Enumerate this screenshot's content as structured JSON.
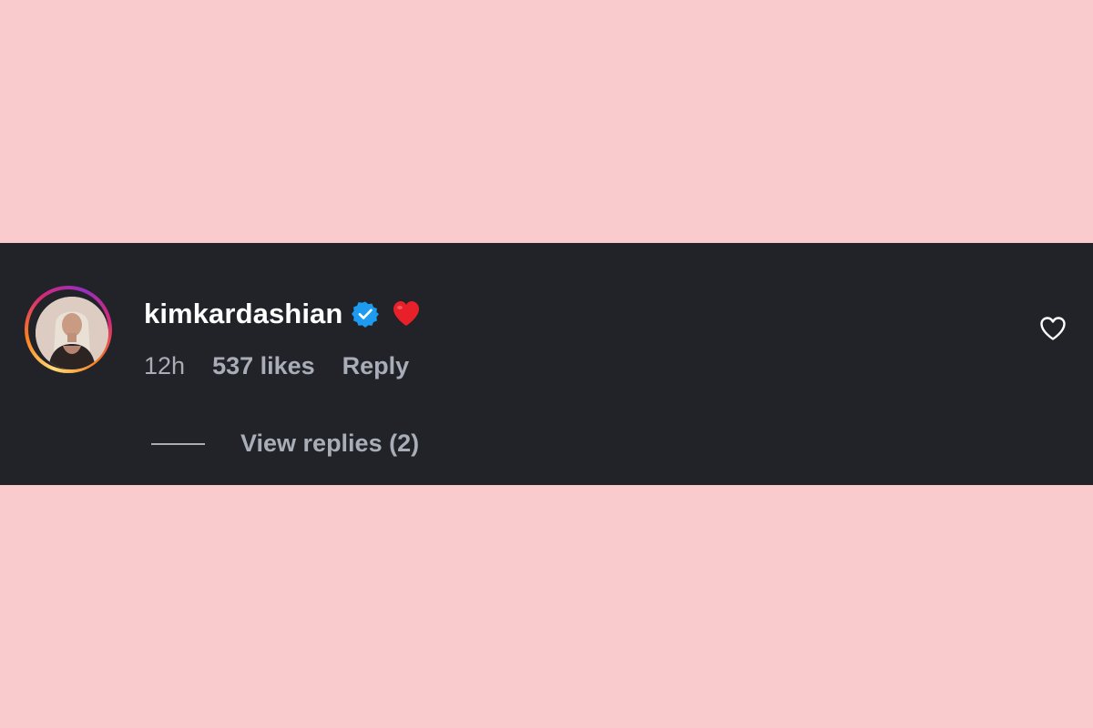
{
  "colors": {
    "background": "#f9cbcc",
    "panel": "#212329",
    "username": "#ffffff",
    "meta_text": "#a8adb7",
    "verified": "#1d9bf0",
    "heart_emoji": "#e8202a"
  },
  "comment": {
    "avatar_icon": "profile-photo",
    "username": "kimkardashian",
    "verified": true,
    "verified_icon": "verified-badge-icon",
    "comment_text_icon": "red-heart-emoji",
    "time": "12h",
    "likes": "537 likes",
    "reply_label": "Reply",
    "like_icon": "heart-outline-icon",
    "view_replies_label": "View replies (2)"
  }
}
